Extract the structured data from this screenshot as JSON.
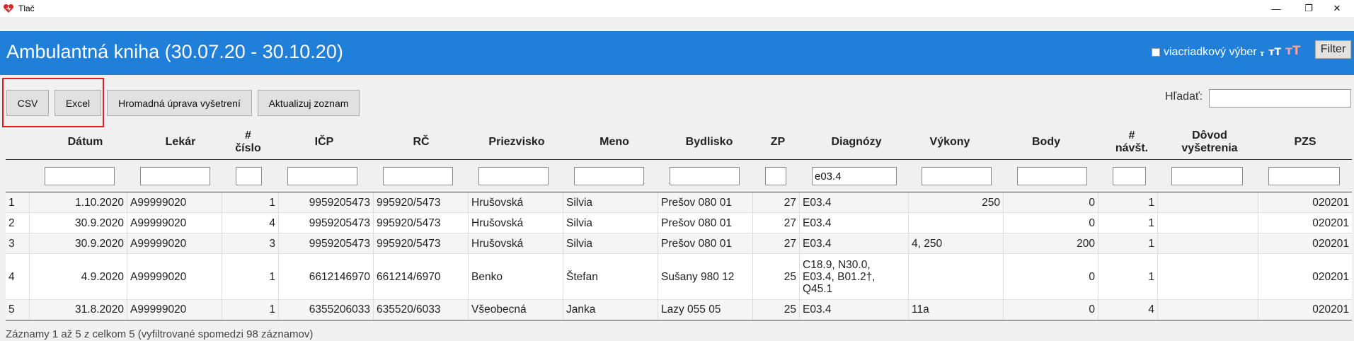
{
  "window": {
    "title": "Tlač",
    "minimize": "—",
    "maximize": "❐",
    "close": "✕",
    "icon": "heart-logo-icon"
  },
  "header": {
    "title": "Ambulantná kniha (30.07.20 - 30.10.20)",
    "multiline_label": "viacriadkový výber",
    "multiline_checked": false,
    "font_small": "т",
    "font_medium": "тТ",
    "font_large": "тТ",
    "filter_label": "Filter",
    "bg_color": "#1f7fd9"
  },
  "toolbar": {
    "csv_label": "CSV",
    "excel_label": "Excel",
    "mass_edit_label": "Hromadná úprava vyšetrení",
    "refresh_label": "Aktualizuj zoznam",
    "search_label": "Hľadať:",
    "search_value": ""
  },
  "table": {
    "headers": {
      "datum": "Dátum",
      "lekar": "Lekár",
      "cislo_1": "#",
      "cislo_2": "číslo",
      "icp": "IČP",
      "rc": "RČ",
      "priezvisko": "Priezvisko",
      "meno": "Meno",
      "bydlisko": "Bydlisko",
      "zp": "ZP",
      "diagnozy": "Diagnózy",
      "vykony": "Výkony",
      "body": "Body",
      "navst_1": "#",
      "navst_2": "návšt.",
      "dovod_1": "Dôvod",
      "dovod_2": "vyšetrenia",
      "pzs": "PZS"
    },
    "filters": {
      "diagnozy": "e03.4"
    },
    "rows": [
      {
        "n": "1",
        "datum": "1.10.2020",
        "lekar": "A99999020",
        "cislo": "1",
        "icp": "9959205473",
        "rc": "995920/5473",
        "priezvisko": "Hrušovská",
        "meno": "Silvia",
        "bydlisko": "Prešov 080 01",
        "zp": "27",
        "diagnozy": "E03.4",
        "vykony": "250",
        "body": "0",
        "navst": "1",
        "dovod": "",
        "pzs": "020201"
      },
      {
        "n": "2",
        "datum": "30.9.2020",
        "lekar": "A99999020",
        "cislo": "4",
        "icp": "9959205473",
        "rc": "995920/5473",
        "priezvisko": "Hrušovská",
        "meno": "Silvia",
        "bydlisko": "Prešov 080 01",
        "zp": "27",
        "diagnozy": "E03.4",
        "vykony": "",
        "body": "0",
        "navst": "1",
        "dovod": "",
        "pzs": "020201"
      },
      {
        "n": "3",
        "datum": "30.9.2020",
        "lekar": "A99999020",
        "cislo": "3",
        "icp": "9959205473",
        "rc": "995920/5473",
        "priezvisko": "Hrušovská",
        "meno": "Silvia",
        "bydlisko": "Prešov 080 01",
        "zp": "27",
        "diagnozy": "E03.4",
        "vykony": "4, 250",
        "body": "200",
        "navst": "1",
        "dovod": "",
        "pzs": "020201"
      },
      {
        "n": "4",
        "datum": "4.9.2020",
        "lekar": "A99999020",
        "cislo": "1",
        "icp": "6612146970",
        "rc": "661214/6970",
        "priezvisko": "Benko",
        "meno": "Štefan",
        "bydlisko": "Sušany 980 12",
        "zp": "25",
        "diagnozy_lines": [
          "C18.9, N30.0,",
          "E03.4, B01.2†,",
          "Q45.1"
        ],
        "vykony": "",
        "body": "0",
        "navst": "1",
        "dovod": "",
        "pzs": "020201"
      },
      {
        "n": "5",
        "datum": "31.8.2020",
        "lekar": "A99999020",
        "cislo": "1",
        "icp": "6355206033",
        "rc": "635520/6033",
        "priezvisko": "Všeobecná",
        "meno": "Janka",
        "bydlisko": "Lazy 055 05",
        "zp": "25",
        "diagnozy": "E03.4",
        "vykony": "11a",
        "body": "0",
        "navst": "4",
        "dovod": "",
        "pzs": "020201"
      }
    ]
  },
  "footer": {
    "info": "Záznamy 1 až 5 z celkom 5 (vyfiltrované spomedzi 98 záznamov)"
  }
}
